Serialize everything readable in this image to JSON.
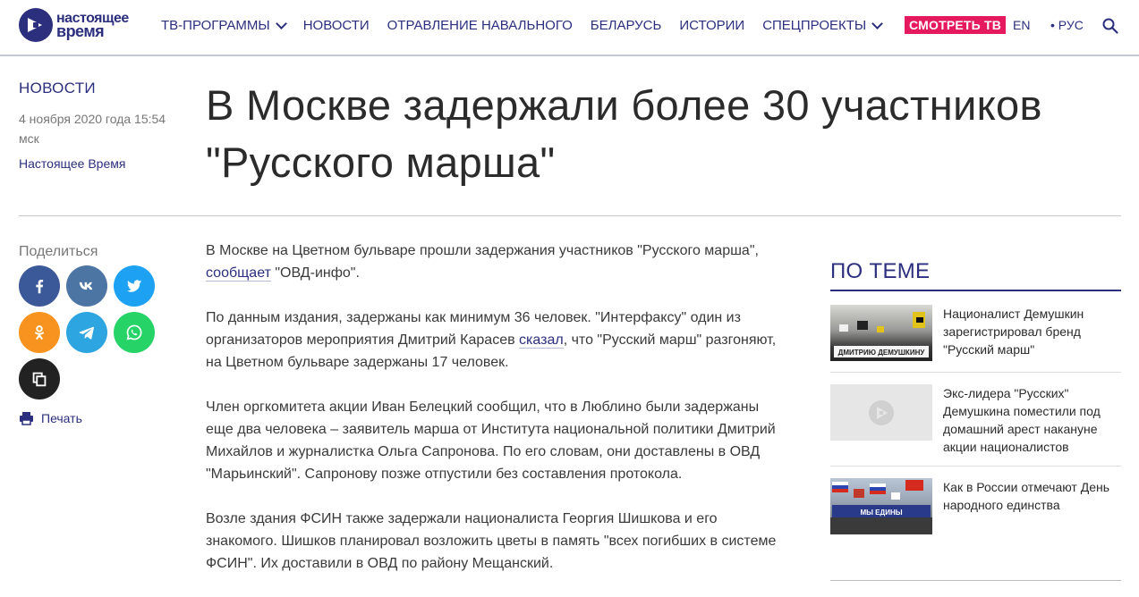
{
  "header": {
    "logo_line1": "настоящее",
    "logo_line2": "время",
    "nav": [
      {
        "label": "ТВ-ПРОГРАММЫ",
        "dropdown": true
      },
      {
        "label": "НОВОСТИ"
      },
      {
        "label": "ОТРАВЛЕНИЕ НАВАЛЬНОГО"
      },
      {
        "label": "БЕЛАРУСЬ"
      },
      {
        "label": "ИСТОРИИ"
      },
      {
        "label": "СПЕЦПРОЕКТЫ",
        "dropdown": true
      }
    ],
    "watch_tv": "СМОТРЕТЬ ТВ",
    "lang_en": "EN",
    "lang_ru": "• РУС",
    "brand_color": "#2b2f7e",
    "accent_color": "#e4195e"
  },
  "article": {
    "category": "НОВОСТИ",
    "date": "4 ноября 2020 года 15:54 мск",
    "source": "Настоящее Время",
    "title": "В Москве задержали более 30 участников \"Русского марша\"",
    "p1_text": "В Москве на Цветном бульваре прошли задержания участников \"Русского марша\",",
    "p1_link": "сообщает",
    "p1_tail": " \"ОВД-инфо\".",
    "p2_text": "По данным издания, задержаны как минимум 36 человек. \"Интерфаксу\" один из организаторов мероприятия Дмитрий Карасев ",
    "p2_link": "сказал",
    "p2_tail": ", что \"Русский марш\" разгоняют, на Цветном бульваре задержаны 17 человек.",
    "p3": "Член оргкомитета акции Иван Белецкий сообщил, что в Люблино были задержаны еще два человека – заявитель марша от Института национальной политики Дмитрий Михайлов и журналистка Ольга Сапронова. По его словам, они доставлены в ОВД \"Марьинский\". Сапронову позже отпустили без составления протокола.",
    "p4": "Возле здания ФСИН также задержали националиста Георгия Шишкова и его знакомого. Шишков планировал возложить цветы в память \"всех погибших в системе ФСИН\". Их доставили в ОВД по району Мещанский."
  },
  "share": {
    "label": "Поделиться",
    "buttons": [
      {
        "name": "facebook-icon",
        "color": "#3b5998",
        "glyph": "f"
      },
      {
        "name": "vk-icon",
        "color": "#4c75a3",
        "glyph": "vk"
      },
      {
        "name": "twitter-icon",
        "color": "#1da1f2",
        "glyph": "tw"
      },
      {
        "name": "odnoklassniki-icon",
        "color": "#f7931e",
        "glyph": "ok"
      },
      {
        "name": "telegram-icon",
        "color": "#2ca5e0",
        "glyph": "tg"
      },
      {
        "name": "whatsapp-icon",
        "color": "#25d366",
        "glyph": "wa"
      },
      {
        "name": "copy-link-icon",
        "color": "#222222",
        "glyph": "cp"
      }
    ],
    "print_label": "Печать"
  },
  "related": {
    "title": "ПО ТЕМЕ",
    "items": [
      {
        "title": "Националист Демушкин зарегистрировал бренд \"Русский марш\"",
        "image": "photo-flags-banner"
      },
      {
        "title": "Экс-лидера \"Русских\" Демушкина поместили под домашний арест накануне акции националистов",
        "image": "placeholder-logo"
      },
      {
        "title": "Как в России отмечают День народного единства",
        "image": "photo-march-flags"
      }
    ]
  }
}
